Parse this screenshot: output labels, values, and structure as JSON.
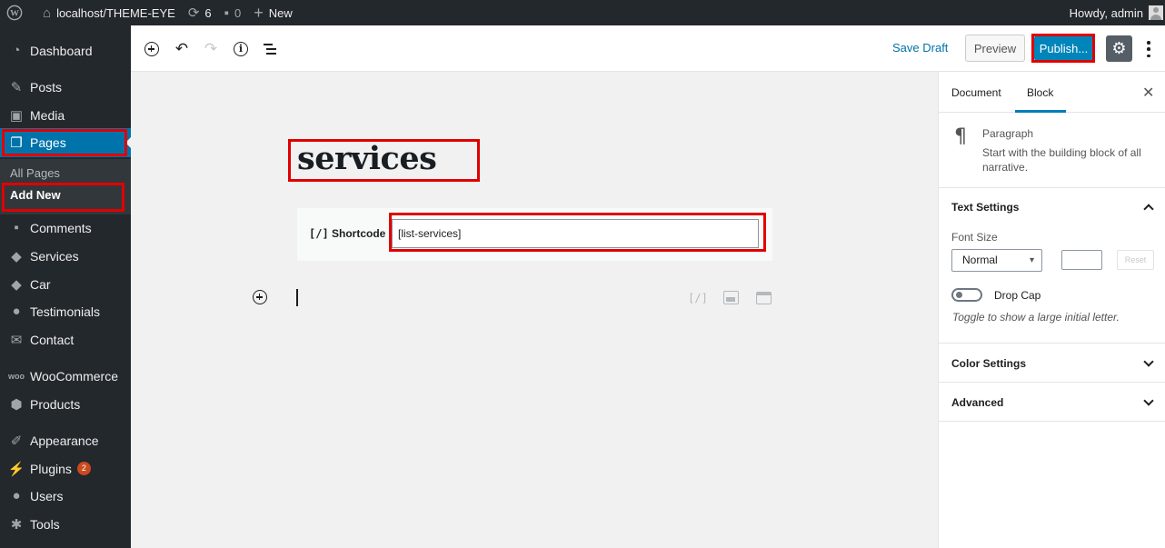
{
  "admin_bar": {
    "site_name": "localhost/THEME-EYE",
    "updates_count": "6",
    "comments_count": "0",
    "new_label": "New",
    "greeting": "Howdy, admin"
  },
  "sidebar": {
    "items": [
      {
        "label": "Dashboard",
        "icon": "dashboard-icon"
      },
      {
        "label": "Posts",
        "icon": "pin-icon"
      },
      {
        "label": "Media",
        "icon": "media-icon"
      },
      {
        "label": "Pages",
        "icon": "pages-icon"
      },
      {
        "label": "Comments",
        "icon": "comment-icon"
      },
      {
        "label": "Services",
        "icon": "tag-icon"
      },
      {
        "label": "Car",
        "icon": "tag-icon"
      },
      {
        "label": "Testimonials",
        "icon": "users-icon"
      },
      {
        "label": "Contact",
        "icon": "mail-icon"
      },
      {
        "label": "WooCommerce",
        "icon": "woo-icon"
      },
      {
        "label": "Products",
        "icon": "box-icon"
      },
      {
        "label": "Appearance",
        "icon": "brush-icon"
      },
      {
        "label": "Plugins",
        "icon": "plugin-icon",
        "badge": "2"
      },
      {
        "label": "Users",
        "icon": "user-icon"
      },
      {
        "label": "Tools",
        "icon": "wrench-icon"
      }
    ],
    "submenu": {
      "all_pages": "All Pages",
      "add_new": "Add New"
    }
  },
  "toolbar": {
    "save_draft": "Save Draft",
    "preview": "Preview",
    "publish": "Publish..."
  },
  "editor": {
    "title": "services",
    "shortcode_icon": "[/]",
    "shortcode_label": "Shortcode",
    "shortcode_value": "[list-services]"
  },
  "panel": {
    "tabs": [
      "Document",
      "Block"
    ],
    "active_tab": "Block",
    "block_title": "Paragraph",
    "block_desc": "Start with the building block of all narrative.",
    "text_settings": "Text Settings",
    "font_size_label": "Font Size",
    "font_size_value": "Normal",
    "reset_label": "Reset",
    "drop_cap_label": "Drop Cap",
    "drop_cap_help": "Toggle to show a large initial letter.",
    "color_settings": "Color Settings",
    "advanced": "Advanced"
  },
  "colors": {
    "admin_dark": "#23282d",
    "accent_blue": "#0073aa",
    "publish_blue": "#0085ba",
    "highlight_red": "#e00000"
  }
}
